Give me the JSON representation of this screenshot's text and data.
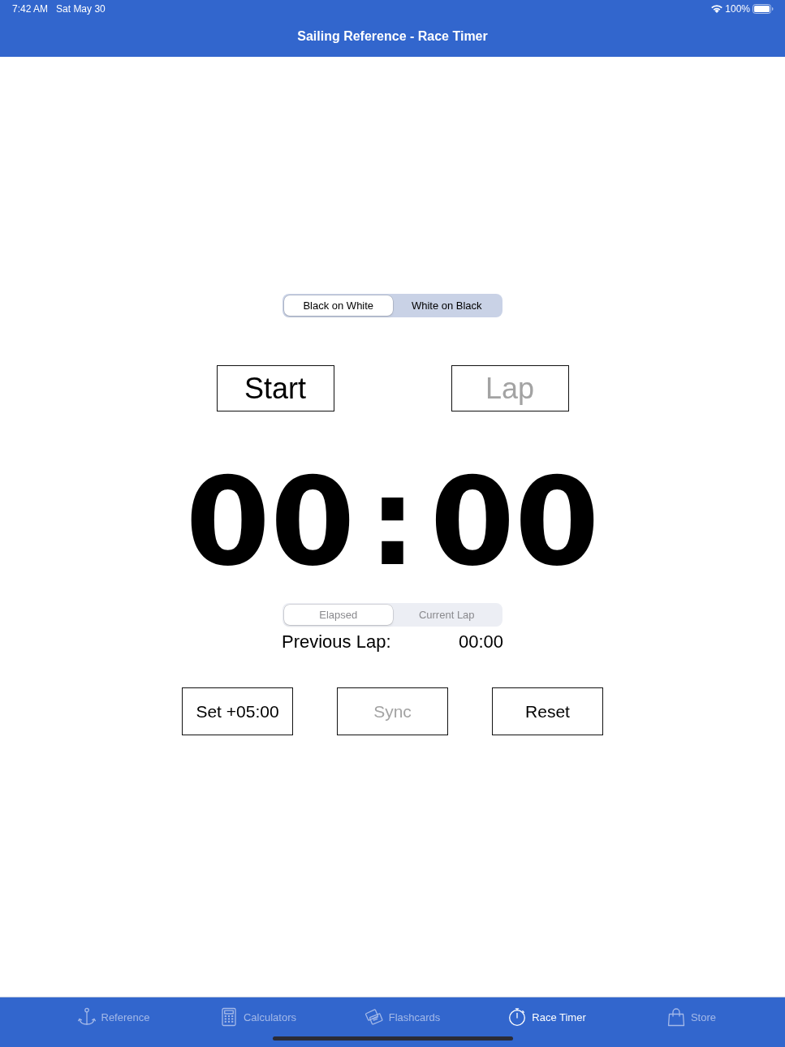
{
  "status_bar": {
    "time": "7:42 AM",
    "date": "Sat May 30",
    "battery": "100%"
  },
  "nav_bar": {
    "title": "Sailing Reference - Race Timer"
  },
  "theme_toggle": {
    "segments": [
      {
        "label": "Black on White",
        "selected": true
      },
      {
        "label": "White on Black",
        "selected": false
      }
    ]
  },
  "actions": [
    {
      "label": "Start",
      "disabled": false
    },
    {
      "label": "Lap",
      "disabled": true
    }
  ],
  "timer": {
    "display": "00 : 00"
  },
  "mode_toggle": {
    "disabled": true,
    "segments": [
      {
        "label": "Elapsed",
        "selected": true
      },
      {
        "label": "Current Lap",
        "selected": false
      }
    ]
  },
  "previous_lap": {
    "label": "Previous Lap:",
    "value": "00:00"
  },
  "controls": [
    {
      "label": "Set +05:00",
      "disabled": false
    },
    {
      "label": "Sync",
      "disabled": true
    },
    {
      "label": "Reset",
      "disabled": false
    }
  ],
  "tab_bar": {
    "items": [
      {
        "label": "Reference",
        "selected": false
      },
      {
        "label": "Calculators",
        "selected": false
      },
      {
        "label": "Flashcards",
        "selected": false
      },
      {
        "label": "Race Timer",
        "selected": true
      },
      {
        "label": "Store",
        "selected": false
      }
    ]
  }
}
